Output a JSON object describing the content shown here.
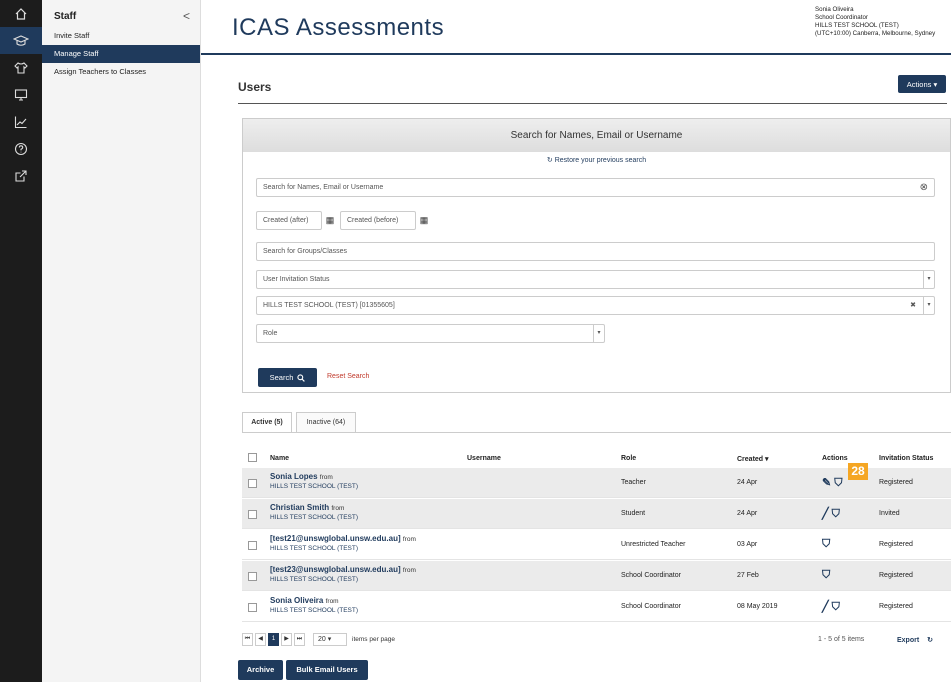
{
  "rail": {
    "icons": [
      "home-icon",
      "graduation-cap-icon",
      "shirt-icon",
      "monitor-icon",
      "chart-icon",
      "help-icon",
      "external-link-icon"
    ]
  },
  "sidebar": {
    "title": "Staff",
    "collapse": "<",
    "items": [
      {
        "label": "Invite Staff"
      },
      {
        "label": "Manage Staff"
      },
      {
        "label": "Assign Teachers to Classes"
      }
    ]
  },
  "header": {
    "brand": "ICAS Assessments",
    "user_name": "Sonia Oliveira",
    "user_role": "School Coordinator",
    "school": "HILLS TEST SCHOOL (TEST)",
    "timezone": "(UTC+10:00) Canberra, Melbourne, Sydney"
  },
  "page": {
    "title": "Users",
    "actions_label": "Actions ▾"
  },
  "search": {
    "panel_title": "Search for Names, Email or Username",
    "restore_label": "Restore your previous search",
    "names_placeholder": "Search for Names, Email or Username",
    "created_after": "Created (after)",
    "created_before": "Created (before)",
    "groups_placeholder": "Search for Groups/Classes",
    "invitation_status": "User Invitation Status",
    "school_value": "HILLS TEST SCHOOL (TEST) [01355605]",
    "role": "Role",
    "search_label": "Search",
    "reset_label": "Reset Search"
  },
  "tabs": [
    {
      "label": "Active (5)"
    },
    {
      "label": "Inactive (64)"
    }
  ],
  "table": {
    "headers": {
      "name": "Name",
      "username": "Username",
      "role": "Role",
      "created": "Created ▾",
      "actions": "Actions",
      "status": "Invitation Status"
    },
    "rows": [
      {
        "name": "Sonia Lopes",
        "from": "from",
        "school": "HILLS TEST SCHOOL (TEST)",
        "role": "Teacher",
        "created": "24 Apr",
        "actions": "✎ ⛉",
        "status": "Registered"
      },
      {
        "name": "Christian Smith",
        "from": "from",
        "school": "HILLS TEST SCHOOL (TEST)",
        "role": "Student",
        "created": "24 Apr",
        "actions": "╱ ⛉",
        "status": "Invited"
      },
      {
        "name": "[test21@unswglobal.unsw.edu.au]",
        "from": "from",
        "school": "HILLS TEST SCHOOL (TEST)",
        "role": "Unrestricted Teacher",
        "created": "03 Apr",
        "actions": "⛉",
        "status": "Registered"
      },
      {
        "name": "[test23@unswglobal.unsw.edu.au]",
        "from": "from",
        "school": "HILLS TEST SCHOOL (TEST)",
        "role": "School Coordinator",
        "created": "27 Feb",
        "actions": "⛉",
        "status": "Registered"
      },
      {
        "name": "Sonia Oliveira",
        "from": "from",
        "school": "HILLS TEST SCHOOL (TEST)",
        "role": "School Coordinator",
        "created": "08 May 2019",
        "actions": "╱ ⛉",
        "status": "Registered"
      }
    ]
  },
  "badge": "28",
  "pager": {
    "first": "⏮",
    "prev": "◀",
    "page": "1",
    "next": "▶",
    "last": "⏭",
    "per_page": "20 ▾",
    "per_page_label": "items per page",
    "count": "1 - 5 of 5 items",
    "export": "Export"
  },
  "buttons": {
    "archive": "Archive",
    "bulk_email": "Bulk Email Users"
  }
}
